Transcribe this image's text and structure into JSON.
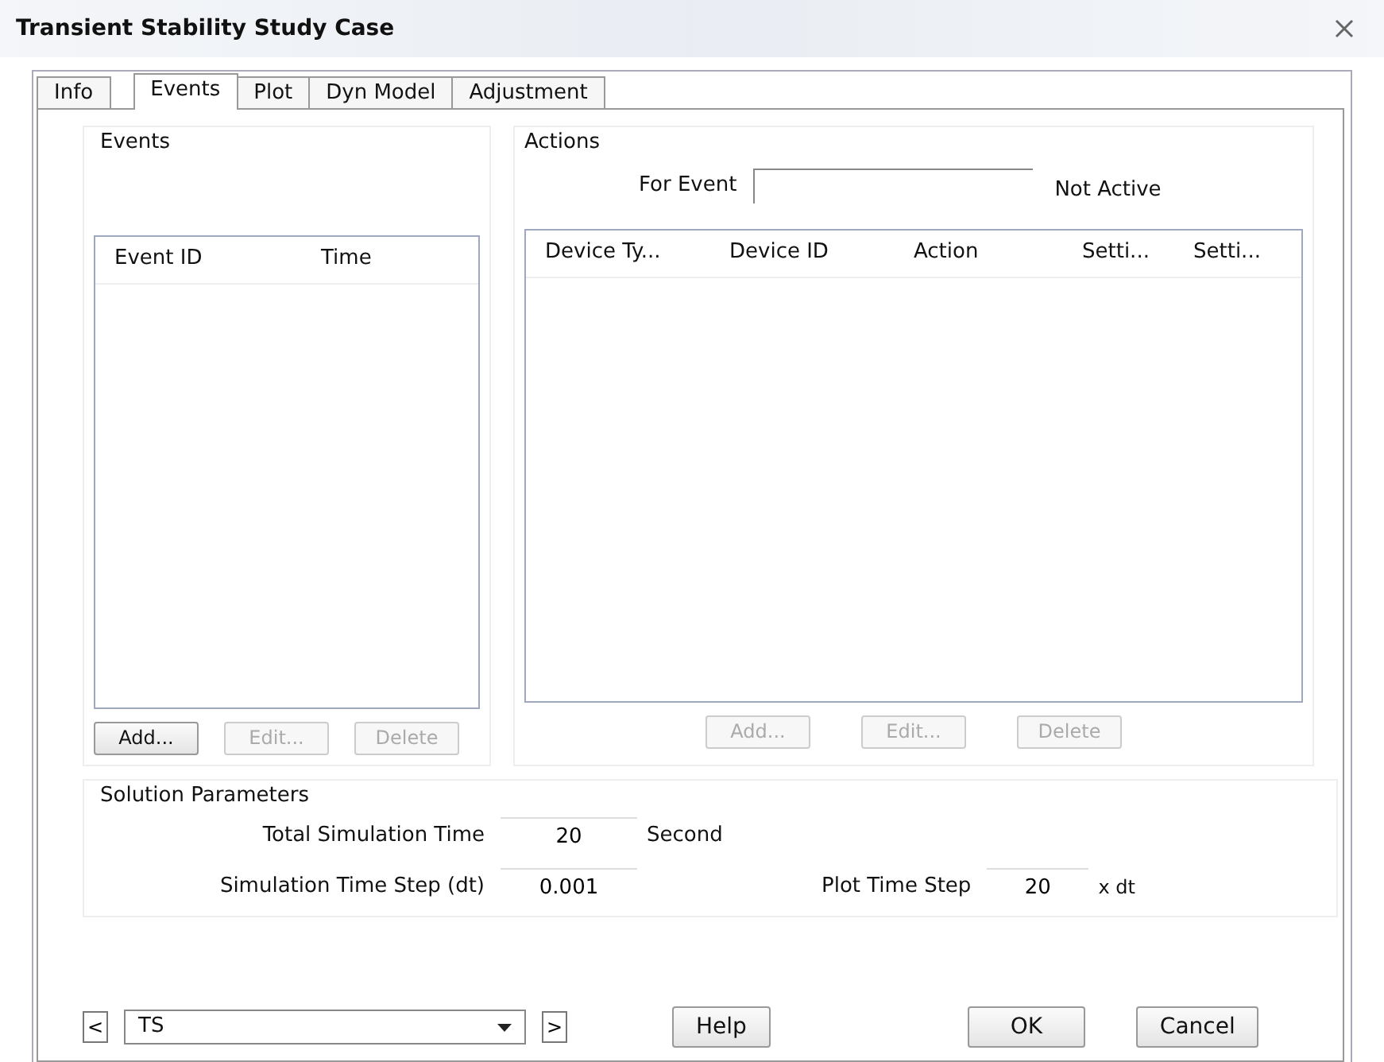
{
  "window": {
    "title": "Transient Stability Study Case"
  },
  "tabs": [
    {
      "label": "Info",
      "selected": false
    },
    {
      "label": "Events",
      "selected": true
    },
    {
      "label": "Plot",
      "selected": false
    },
    {
      "label": "Dyn Model",
      "selected": false
    },
    {
      "label": "Adjustment",
      "selected": false
    }
  ],
  "events": {
    "title": "Events",
    "columns": [
      "Event ID",
      "Time"
    ],
    "buttons": [
      {
        "label": "Add...",
        "disabled": false
      },
      {
        "label": "Edit...",
        "disabled": true
      },
      {
        "label": "Delete",
        "disabled": true
      }
    ]
  },
  "actions": {
    "title": "Actions",
    "for_event_label": "For Event",
    "status": "Not Active",
    "columns": [
      "Device Ty...",
      "Device ID",
      "Action",
      "Setti...",
      "Setti..."
    ],
    "buttons": [
      {
        "label": "Add...",
        "disabled": true
      },
      {
        "label": "Edit...",
        "disabled": true
      },
      {
        "label": "Delete",
        "disabled": true
      }
    ]
  },
  "solution_parameters": {
    "title": "Solution Parameters",
    "total_simulation_time": {
      "label": "Total Simulation Time",
      "value": "20",
      "unit": "Second"
    },
    "time_step": {
      "label": "Simulation Time Step (dt)",
      "value": "0.001"
    },
    "plot_time_step": {
      "label": "Plot Time Step",
      "value": "20",
      "unit": "x dt"
    }
  },
  "footer": {
    "prev": "<",
    "case": "TS",
    "next": ">",
    "buttons": [
      "Help",
      "OK",
      "Cancel"
    ]
  }
}
